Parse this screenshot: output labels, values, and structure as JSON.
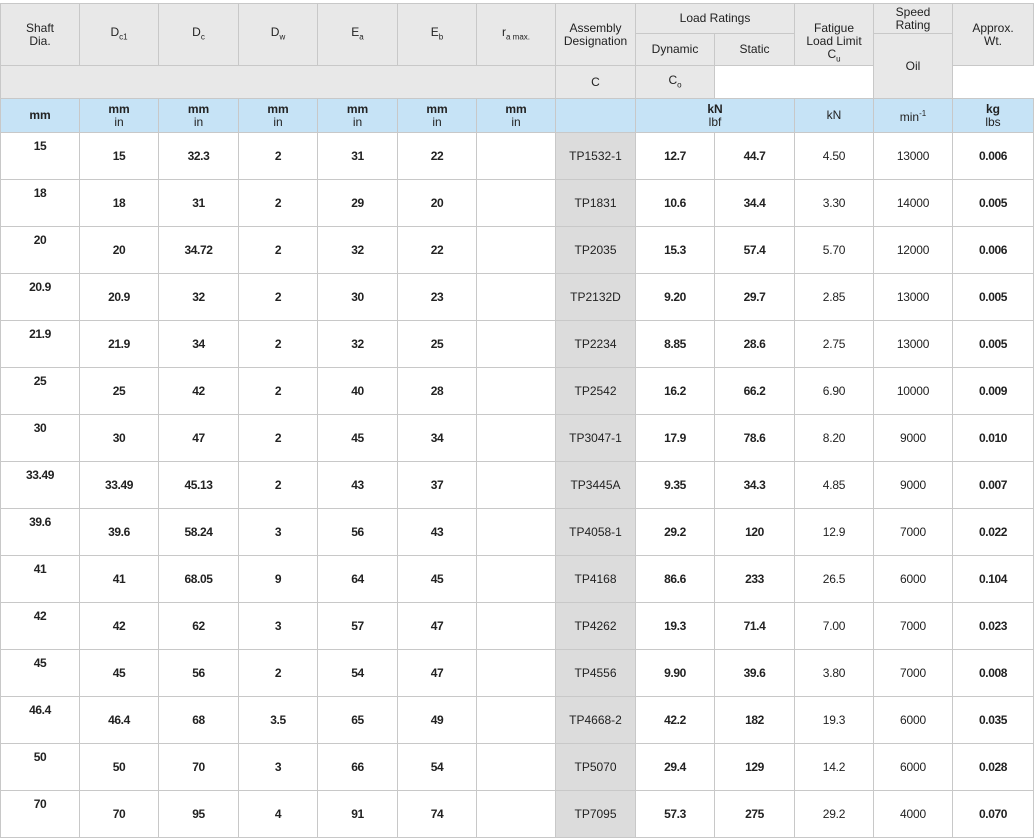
{
  "headers": {
    "shaft": "Shaft\nDia.",
    "dc1": "D",
    "dc1_sub": "c1",
    "dc": "D",
    "dc_sub": "c",
    "dw": "D",
    "dw_sub": "w",
    "ea": "E",
    "ea_sub": "a",
    "eb": "E",
    "eb_sub": "b",
    "ra": "r",
    "ra_sub": "a max.",
    "assembly": "Assembly\nDesignation",
    "load_ratings": "Load Ratings",
    "dynamic": "Dynamic",
    "static": "Static",
    "c": "C",
    "co": "C",
    "co_sub": "o",
    "fatigue": "Fatigue\nLoad Limit",
    "cu": "C",
    "cu_sub": "u",
    "speed": "Speed\nRating",
    "oil": "Oil",
    "weight": "Approx.\nWt."
  },
  "units": {
    "shaft": "mm",
    "mm": "mm",
    "in": "in",
    "kn": "kN",
    "lbf": "lbf",
    "fatigue": "kN",
    "speed": "min",
    "speed_sup": "-1",
    "kg": "kg",
    "lbs": "lbs"
  },
  "rows": [
    {
      "shaft": "15",
      "dc1": "15",
      "dc": "32.3",
      "dw": "2",
      "ea": "31",
      "eb": "22",
      "ra": "",
      "desig": "TP1532-1",
      "c": "12.7",
      "co": "44.7",
      "cu": "4.50",
      "oil": "13000",
      "wt": "0.006"
    },
    {
      "shaft": "18",
      "dc1": "18",
      "dc": "31",
      "dw": "2",
      "ea": "29",
      "eb": "20",
      "ra": "",
      "desig": "TP1831",
      "c": "10.6",
      "co": "34.4",
      "cu": "3.30",
      "oil": "14000",
      "wt": "0.005"
    },
    {
      "shaft": "20",
      "dc1": "20",
      "dc": "34.72",
      "dw": "2",
      "ea": "32",
      "eb": "22",
      "ra": "",
      "desig": "TP2035",
      "c": "15.3",
      "co": "57.4",
      "cu": "5.70",
      "oil": "12000",
      "wt": "0.006"
    },
    {
      "shaft": "20.9",
      "dc1": "20.9",
      "dc": "32",
      "dw": "2",
      "ea": "30",
      "eb": "23",
      "ra": "",
      "desig": "TP2132D",
      "c": "9.20",
      "co": "29.7",
      "cu": "2.85",
      "oil": "13000",
      "wt": "0.005"
    },
    {
      "shaft": "21.9",
      "dc1": "21.9",
      "dc": "34",
      "dw": "2",
      "ea": "32",
      "eb": "25",
      "ra": "",
      "desig": "TP2234",
      "c": "8.85",
      "co": "28.6",
      "cu": "2.75",
      "oil": "13000",
      "wt": "0.005"
    },
    {
      "shaft": "25",
      "dc1": "25",
      "dc": "42",
      "dw": "2",
      "ea": "40",
      "eb": "28",
      "ra": "",
      "desig": "TP2542",
      "c": "16.2",
      "co": "66.2",
      "cu": "6.90",
      "oil": "10000",
      "wt": "0.009"
    },
    {
      "shaft": "30",
      "dc1": "30",
      "dc": "47",
      "dw": "2",
      "ea": "45",
      "eb": "34",
      "ra": "",
      "desig": "TP3047-1",
      "c": "17.9",
      "co": "78.6",
      "cu": "8.20",
      "oil": "9000",
      "wt": "0.010"
    },
    {
      "shaft": "33.49",
      "dc1": "33.49",
      "dc": "45.13",
      "dw": "2",
      "ea": "43",
      "eb": "37",
      "ra": "",
      "desig": "TP3445A",
      "c": "9.35",
      "co": "34.3",
      "cu": "4.85",
      "oil": "9000",
      "wt": "0.007"
    },
    {
      "shaft": "39.6",
      "dc1": "39.6",
      "dc": "58.24",
      "dw": "3",
      "ea": "56",
      "eb": "43",
      "ra": "",
      "desig": "TP4058-1",
      "c": "29.2",
      "co": "120",
      "cu": "12.9",
      "oil": "7000",
      "wt": "0.022"
    },
    {
      "shaft": "41",
      "dc1": "41",
      "dc": "68.05",
      "dw": "9",
      "ea": "64",
      "eb": "45",
      "ra": "",
      "desig": "TP4168",
      "c": "86.6",
      "co": "233",
      "cu": "26.5",
      "oil": "6000",
      "wt": "0.104"
    },
    {
      "shaft": "42",
      "dc1": "42",
      "dc": "62",
      "dw": "3",
      "ea": "57",
      "eb": "47",
      "ra": "",
      "desig": "TP4262",
      "c": "19.3",
      "co": "71.4",
      "cu": "7.00",
      "oil": "7000",
      "wt": "0.023"
    },
    {
      "shaft": "45",
      "dc1": "45",
      "dc": "56",
      "dw": "2",
      "ea": "54",
      "eb": "47",
      "ra": "",
      "desig": "TP4556",
      "c": "9.90",
      "co": "39.6",
      "cu": "3.80",
      "oil": "7000",
      "wt": "0.008"
    },
    {
      "shaft": "46.4",
      "dc1": "46.4",
      "dc": "68",
      "dw": "3.5",
      "ea": "65",
      "eb": "49",
      "ra": "",
      "desig": "TP4668-2",
      "c": "42.2",
      "co": "182",
      "cu": "19.3",
      "oil": "6000",
      "wt": "0.035"
    },
    {
      "shaft": "50",
      "dc1": "50",
      "dc": "70",
      "dw": "3",
      "ea": "66",
      "eb": "54",
      "ra": "",
      "desig": "TP5070",
      "c": "29.4",
      "co": "129",
      "cu": "14.2",
      "oil": "6000",
      "wt": "0.028"
    },
    {
      "shaft": "70",
      "dc1": "70",
      "dc": "95",
      "dw": "4",
      "ea": "91",
      "eb": "74",
      "ra": "",
      "desig": "TP7095",
      "c": "57.3",
      "co": "275",
      "cu": "29.2",
      "oil": "4000",
      "wt": "0.070"
    }
  ]
}
